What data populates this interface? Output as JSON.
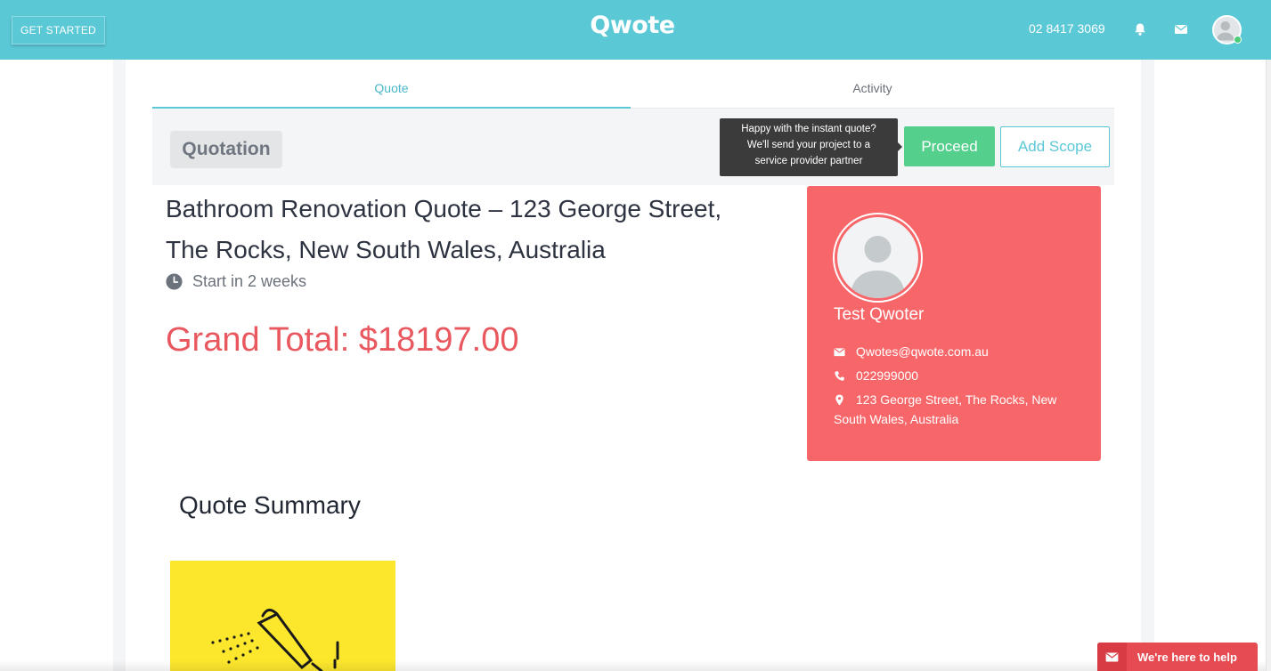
{
  "header": {
    "get_started_label": "GET STARTED",
    "logo_text": "Qwote",
    "phone": "02 8417 3069",
    "brand_color": "#5bc8d6"
  },
  "tabs": [
    {
      "label": "Quote",
      "active": true
    },
    {
      "label": "Activity",
      "active": false
    }
  ],
  "quote_header": {
    "badge": "Quotation",
    "tooltip_lines": [
      "Happy with the instant quote?",
      "We'll send your project to a",
      "service provider partner"
    ],
    "proceed_label": "Proceed",
    "add_scope_label": "Add Scope"
  },
  "quote": {
    "title_line1": "Bathroom Renovation Quote – 123 George Street,",
    "title_line2": "The Rocks, New South Wales, Australia",
    "start": "Start in 2 weeks",
    "grand_total": "Grand Total: $18197.00"
  },
  "contact": {
    "name": "Test Qwoter",
    "email": "Qwotes@qwote.com.au",
    "phone": "022999000",
    "address_line1": "123 George Street, The Rocks, New",
    "address_line2": "South Wales, Australia",
    "card_color": "#f7676a"
  },
  "summary": {
    "title": "Quote Summary"
  },
  "help_widget": {
    "label": "We're here to help"
  }
}
